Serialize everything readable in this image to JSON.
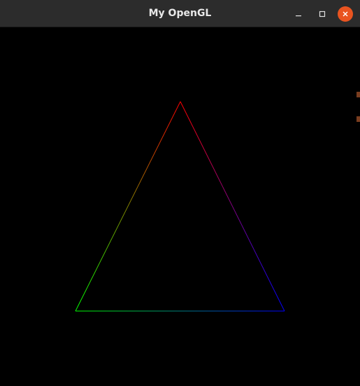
{
  "window": {
    "title": "My OpenGL"
  },
  "controls": {
    "minimize_icon": "minimize-icon",
    "maximize_icon": "maximize-icon",
    "close_icon": "close-icon",
    "close_color": "#e95420"
  },
  "scene": {
    "background_color": "#000000",
    "primitive": "triangle-outline",
    "vertices": [
      {
        "name": "top",
        "color": "#ff0000"
      },
      {
        "name": "bottom-left",
        "color": "#00ff00"
      },
      {
        "name": "bottom-right",
        "color": "#0000ff"
      }
    ]
  }
}
